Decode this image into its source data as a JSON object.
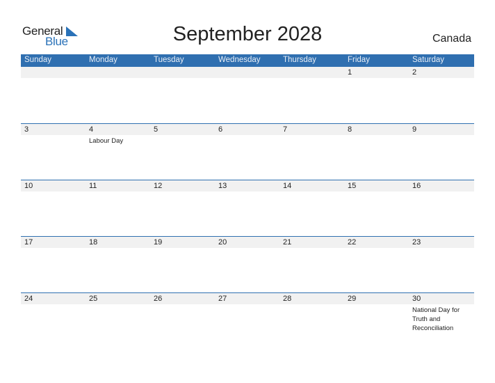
{
  "logo": {
    "word1": "General",
    "word2": "Blue"
  },
  "title": "September 2028",
  "country": "Canada",
  "colors": {
    "accent": "#2f6fb0",
    "date_strip": "#f1f1f1"
  },
  "weekdays": [
    "Sunday",
    "Monday",
    "Tuesday",
    "Wednesday",
    "Thursday",
    "Friday",
    "Saturday"
  ],
  "weeks": [
    {
      "days": [
        {
          "date": "",
          "holiday": ""
        },
        {
          "date": "",
          "holiday": ""
        },
        {
          "date": "",
          "holiday": ""
        },
        {
          "date": "",
          "holiday": ""
        },
        {
          "date": "",
          "holiday": ""
        },
        {
          "date": "1",
          "holiday": ""
        },
        {
          "date": "2",
          "holiday": ""
        }
      ]
    },
    {
      "days": [
        {
          "date": "3",
          "holiday": ""
        },
        {
          "date": "4",
          "holiday": "Labour Day"
        },
        {
          "date": "5",
          "holiday": ""
        },
        {
          "date": "6",
          "holiday": ""
        },
        {
          "date": "7",
          "holiday": ""
        },
        {
          "date": "8",
          "holiday": ""
        },
        {
          "date": "9",
          "holiday": ""
        }
      ]
    },
    {
      "days": [
        {
          "date": "10",
          "holiday": ""
        },
        {
          "date": "11",
          "holiday": ""
        },
        {
          "date": "12",
          "holiday": ""
        },
        {
          "date": "13",
          "holiday": ""
        },
        {
          "date": "14",
          "holiday": ""
        },
        {
          "date": "15",
          "holiday": ""
        },
        {
          "date": "16",
          "holiday": ""
        }
      ]
    },
    {
      "days": [
        {
          "date": "17",
          "holiday": ""
        },
        {
          "date": "18",
          "holiday": ""
        },
        {
          "date": "19",
          "holiday": ""
        },
        {
          "date": "20",
          "holiday": ""
        },
        {
          "date": "21",
          "holiday": ""
        },
        {
          "date": "22",
          "holiday": ""
        },
        {
          "date": "23",
          "holiday": ""
        }
      ]
    },
    {
      "days": [
        {
          "date": "24",
          "holiday": ""
        },
        {
          "date": "25",
          "holiday": ""
        },
        {
          "date": "26",
          "holiday": ""
        },
        {
          "date": "27",
          "holiday": ""
        },
        {
          "date": "28",
          "holiday": ""
        },
        {
          "date": "29",
          "holiday": ""
        },
        {
          "date": "30",
          "holiday": "National Day for Truth and Reconciliation"
        }
      ]
    }
  ]
}
